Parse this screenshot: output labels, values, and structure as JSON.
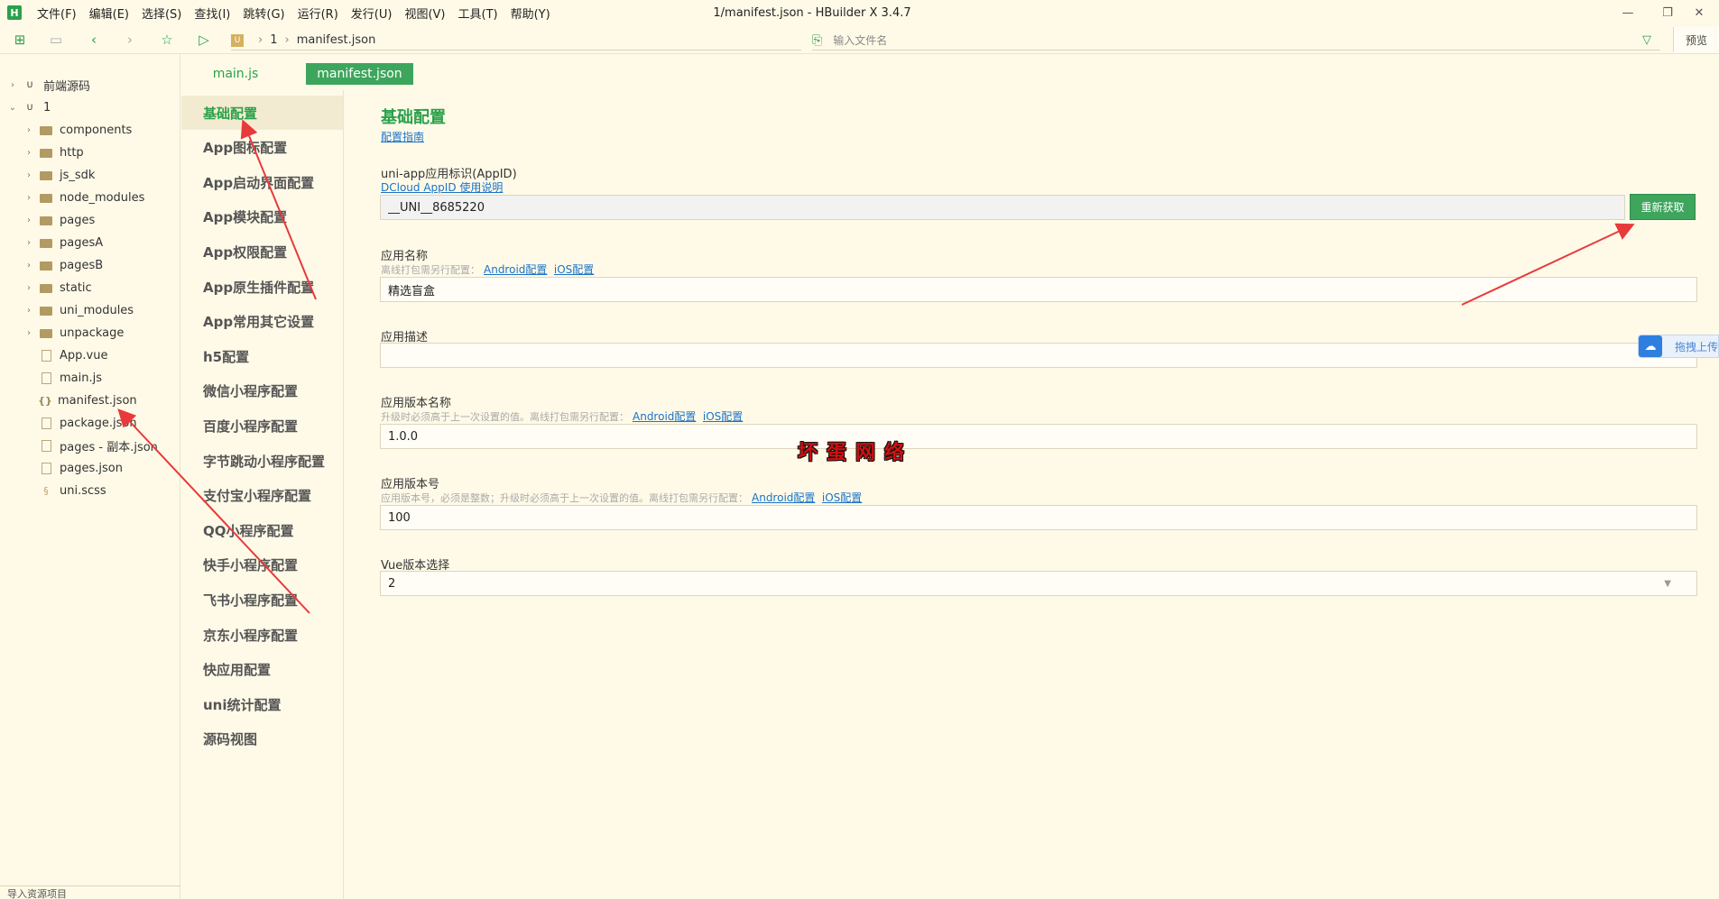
{
  "window": {
    "title": "1/manifest.json - HBuilder X 3.4.7",
    "logo": "H",
    "controls": {
      "minimize": "—",
      "restore": "❐",
      "close": "✕"
    }
  },
  "menu": [
    "文件(F)",
    "编辑(E)",
    "选择(S)",
    "查找(I)",
    "跳转(G)",
    "运行(R)",
    "发行(U)",
    "视图(V)",
    "工具(T)",
    "帮助(Y)"
  ],
  "toolbar": {
    "icons": [
      "new-file-icon",
      "save-icon",
      "back-icon",
      "forward-icon",
      "favorite-icon",
      "run-icon"
    ],
    "breadcrumb": {
      "project": "1",
      "file": "manifest.json"
    },
    "file_search_placeholder": "输入文件名",
    "preview_label": "预览"
  },
  "file_tree": {
    "items": [
      {
        "label": "前端源码",
        "type": "project",
        "arrow": "›",
        "indent": 0
      },
      {
        "label": "1",
        "type": "project",
        "arrow": "⌄",
        "indent": 0
      },
      {
        "label": "components",
        "type": "folder",
        "arrow": "›",
        "indent": 1
      },
      {
        "label": "http",
        "type": "folder",
        "arrow": "›",
        "indent": 1
      },
      {
        "label": "js_sdk",
        "type": "folder",
        "arrow": "›",
        "indent": 1
      },
      {
        "label": "node_modules",
        "type": "folder",
        "arrow": "›",
        "indent": 1
      },
      {
        "label": "pages",
        "type": "folder",
        "arrow": "›",
        "indent": 1
      },
      {
        "label": "pagesA",
        "type": "folder",
        "arrow": "›",
        "indent": 1
      },
      {
        "label": "pagesB",
        "type": "folder",
        "arrow": "›",
        "indent": 1
      },
      {
        "label": "static",
        "type": "folder",
        "arrow": "›",
        "indent": 1
      },
      {
        "label": "uni_modules",
        "type": "folder",
        "arrow": "›",
        "indent": 1
      },
      {
        "label": "unpackage",
        "type": "folder",
        "arrow": "›",
        "indent": 1
      },
      {
        "label": "App.vue",
        "type": "file",
        "arrow": "",
        "indent": 1
      },
      {
        "label": "main.js",
        "type": "file",
        "arrow": "",
        "indent": 1
      },
      {
        "label": "manifest.json",
        "type": "json",
        "arrow": "",
        "indent": 1
      },
      {
        "label": "package.json",
        "type": "file",
        "arrow": "",
        "indent": 1
      },
      {
        "label": "pages - 副本.json",
        "type": "file",
        "arrow": "",
        "indent": 1
      },
      {
        "label": "pages.json",
        "type": "file",
        "arrow": "",
        "indent": 1
      },
      {
        "label": "uni.scss",
        "type": "scss",
        "arrow": "",
        "indent": 1
      }
    ],
    "footer": "导入资源项目"
  },
  "tabs": [
    {
      "label": "main.js",
      "active": false
    },
    {
      "label": "manifest.json",
      "active": true
    }
  ],
  "settings_nav": [
    "基础配置",
    "App图标配置",
    "App启动界面配置",
    "App模块配置",
    "App权限配置",
    "App原生插件配置",
    "App常用其它设置",
    "h5配置",
    "微信小程序配置",
    "百度小程序配置",
    "字节跳动小程序配置",
    "支付宝小程序配置",
    "QQ小程序配置",
    "快手小程序配置",
    "飞书小程序配置",
    "京东小程序配置",
    "快应用配置",
    "uni统计配置",
    "源码视图"
  ],
  "settings_nav_active": 0,
  "form": {
    "title": "基础配置",
    "guide_link": "配置指南",
    "appid": {
      "label": "uni-app应用标识(AppID)",
      "help_link": "DCloud AppID 使用说明",
      "value": "__UNI__8685220",
      "button": "重新获取"
    },
    "app_name": {
      "label": "应用名称",
      "hint": "离线打包需另行配置：",
      "android_link": "Android配置",
      "ios_link": "iOS配置",
      "value": "精选盲盒"
    },
    "app_desc": {
      "label": "应用描述",
      "value": ""
    },
    "version_name": {
      "label": "应用版本名称",
      "hint": "升级时必须高于上一次设置的值。离线打包需另行配置：",
      "android_link": "Android配置",
      "ios_link": "iOS配置",
      "value": "1.0.0"
    },
    "version_code": {
      "label": "应用版本号",
      "hint": "应用版本号，必须是整数；升级时必须高于上一次设置的值。离线打包需另行配置：",
      "android_link": "Android配置",
      "ios_link": "iOS配置",
      "value": "100"
    },
    "vue_version": {
      "label": "Vue版本选择",
      "value": "2"
    }
  },
  "upload_float": "拖拽上传",
  "watermark": "坏蛋网络",
  "colors": {
    "accent": "#3ea55d",
    "link": "#1a73c8",
    "background": "#fffae8",
    "arrow": "#e83a3a"
  }
}
